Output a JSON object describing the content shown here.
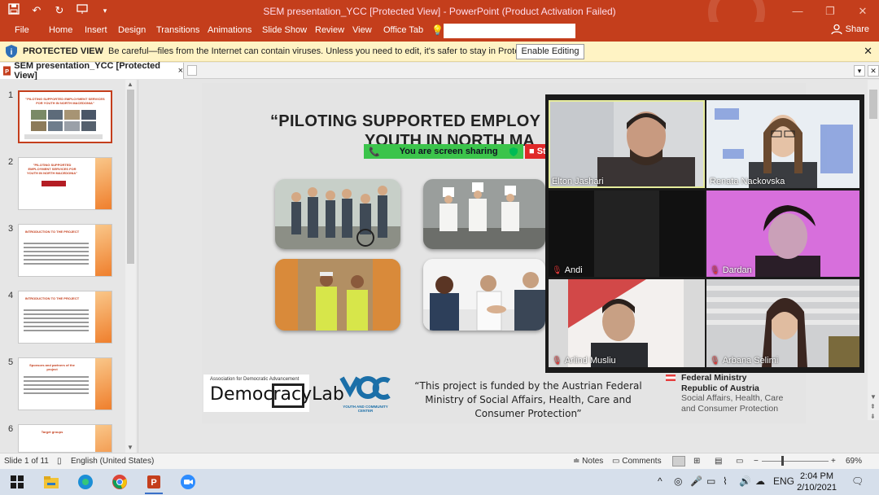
{
  "window": {
    "title": "SEM presentation_YCC [Protected View] - PowerPoint (Product Activation Failed)",
    "controls": [
      "—",
      "❐",
      "✕"
    ]
  },
  "ribbon": {
    "tabs": [
      "File",
      "Home",
      "Insert",
      "Design",
      "Transitions",
      "Animations",
      "Slide Show",
      "Review",
      "View",
      "Office Tab"
    ],
    "share_label": "Share"
  },
  "protected_view": {
    "title": "PROTECTED VIEW",
    "message": "Be careful—files from the Internet can contain viruses. Unless you need to edit, it's safer to stay in Protected View.",
    "enable_button": "Enable Editing"
  },
  "doc_tab": {
    "label": "SEM presentation_YCC [Protected View]",
    "close": "×"
  },
  "thumbnails": [
    {
      "num": "1",
      "title": "\"PILOTING SUPPORTED EMPLOYMENT SERVICES FOR YOUTH IN NORTH MACEDONIA\""
    },
    {
      "num": "2",
      "title": "\"PILOTING SUPPORTED EMPLOYMENT SERVICES FOR YOUTH IN NORTH MACEDONIA\""
    },
    {
      "num": "3",
      "title": "INTRODUCTION TO THE PROJECT"
    },
    {
      "num": "4",
      "title": "INTRODUCTION TO THE PROJECT"
    },
    {
      "num": "5",
      "title": "Sponsors and partners of the project"
    },
    {
      "num": "6",
      "title": "Target groups"
    }
  ],
  "slide": {
    "title_line1": "“PILOTING SUPPORTED EMPLOY",
    "title_line2": "YOUTH IN NORTH MA",
    "democracy_small": "Association for Democratic Advancement",
    "democracy_big": "DemocracyLab",
    "ycc_caption": "YOUTH AND COMMUNITY CENTER",
    "funded_text": "“This project is funded by the Austrian Federal Ministry of Social Affairs, Health, Care and Consumer Protection”",
    "ministry_line1": "Federal Ministry",
    "ministry_line2": "Republic of Austria",
    "ministry_line3": "Social Affairs, Health, Care",
    "ministry_line4": "and Consumer Protection"
  },
  "screen_share": {
    "label": "You are screen sharing",
    "stop": "St"
  },
  "participants": [
    {
      "name": "Elton Jashari",
      "muted": false,
      "active": true
    },
    {
      "name": "Renata Nackovska",
      "muted": false,
      "active": false
    },
    {
      "name": "Andi",
      "muted": true,
      "active": false
    },
    {
      "name": "Dardan",
      "muted": true,
      "active": false
    },
    {
      "name": "Arlind Musliu",
      "muted": true,
      "active": false
    },
    {
      "name": "Arbana Selimi",
      "muted": true,
      "active": false
    }
  ],
  "status": {
    "slide_info": "Slide 1 of 11",
    "language": "English (United States)",
    "notes": "Notes",
    "comments": "Comments",
    "zoom_level": "69%"
  },
  "taskbar": {
    "time": "2:04 PM",
    "date": "2/10/2021",
    "lang": "ENG"
  },
  "colors": {
    "accent": "#c43e1c",
    "share_green": "#3bc44b",
    "pv_yellow": "#fff3c4"
  }
}
